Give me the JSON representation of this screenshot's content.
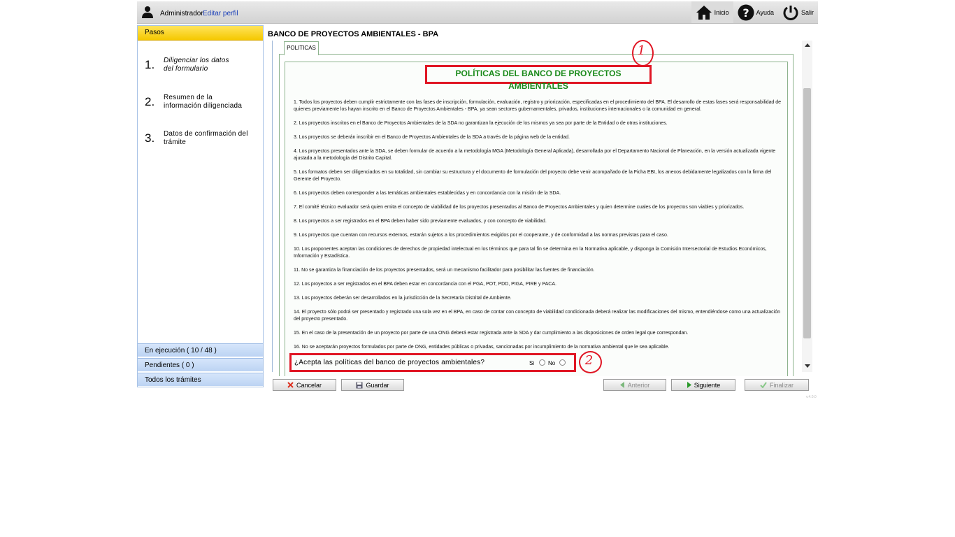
{
  "header": {
    "user_name": "Administrador",
    "edit_profile": "Editar perfil",
    "actions": [
      {
        "label": "Inicio",
        "icon": "home-icon"
      },
      {
        "label": "Ayuda",
        "icon": "help-icon"
      },
      {
        "label": "Salir",
        "icon": "power-icon"
      }
    ]
  },
  "sidebar": {
    "header": "Pasos",
    "steps": [
      {
        "num": "1.",
        "label_line1": "Diligenciar los datos",
        "label_line2": "del formulario"
      },
      {
        "num": "2.",
        "label_line1": "Resumen de la",
        "label_line2": "información diligenciada"
      },
      {
        "num": "3.",
        "label_line1": "Datos de confirmación del",
        "label_line2": "trámite"
      }
    ],
    "footer": [
      {
        "label": "En ejecución ( 10 / 48 )"
      },
      {
        "label": "Pendientes ( 0 )"
      },
      {
        "label": "Todos los trámites"
      }
    ]
  },
  "main": {
    "title": "BANCO DE PROYECTOS AMBIENTALES - BPA",
    "tab_label": "POLITICAS",
    "policy_title": "POLÍTICAS DEL BANCO DE PROYECTOS AMBIENTALES",
    "policies": [
      "1. Todos los proyectos deben cumplir estrictamente con las fases de inscripción, formulación, evaluación, registro y priorización, especificadas en el procedimiento del BPA. El desarrollo de estas fases será responsabilidad de quienes previamente los hayan inscrito en el Banco de Proyectos Ambientales - BPA, ya sean sectores gubernamentales, privados, instituciones internacionales o la comunidad en general.",
      "2. Los proyectos inscritos en el Banco de Proyectos Ambientales de la SDA no garantizan la ejecución de los mismos ya sea por parte de la Entidad o de otras instituciones.",
      "3. Los proyectos se deberán inscribir en el Banco de Proyectos Ambientales de la SDA a través de la página web de la entidad.",
      "4. Los proyectos presentados ante la SDA, se deben formular de acuerdo a la metodología MGA (Metodología General Aplicada), desarrollada por el Departamento Nacional de Planeación, en la versión actualizada vigente ajustada a la metodología del Distrito Capital.",
      "5. Los formatos deben ser diligenciados en su totalidad, sin cambiar su estructura y el documento de formulación del proyecto debe venir acompañado de la Ficha EBI, los anexos debidamente legalizados con la firma del Gerente del Proyecto.",
      "6. Los proyectos deben corresponder a las temáticas ambientales establecidas y en concordancia con la misión de la SDA.",
      "7. El comité técnico evaluador será quien emita el concepto de viabilidad de los proyectos presentados al Banco de Proyectos Ambientales y quien determine cuales de los proyectos son viables y priorizados.",
      "8. Los proyectos a ser registrados en el BPA deben haber sido previamente evaluados, y con concepto de viabilidad.",
      "9. Los proyectos que cuentan con recursos externos, estarán sujetos a los procedimientos exigidos por el cooperante, y de conformidad a las normas previstas para el caso.",
      "10. Los proponentes aceptan las condiciones de derechos de propiedad intelectual en los términos que para tal fin se determina en la Normativa aplicable, y disponga la Comisión Intersectorial de Estudios Económicos, Información y Estadística.",
      "11. No se garantiza la financiación de los proyectos presentados, será un mecanismo facilitador para posibilitar las fuentes de financiación.",
      "12. Los proyectos a ser registrados en el BPA deben estar en concordancia con el PGA, POT, PDD, PIGA, PIRE y PACA.",
      "13. Los proyectos deberán ser desarrollados en la jurisdicción de la Secretaría Distrital de Ambiente.",
      "14. El proyecto sólo podrá ser presentado y registrado una sola vez en el BPA, en caso de contar con concepto de viabilidad condicionada deberá realizar las modificaciones del mismo, entendiéndose como una actualización del proyecto presentado.",
      "15. En el caso de la presentación de un proyecto por parte de una ONG deberá estar registrada ante la SDA y dar cumplimiento a las disposiciones de orden legal que correspondan.",
      "16. No se aceptarán proyectos formulados por parte de ONG, entidades públicas o privadas, sancionadas por incumplimiento de la normativa ambiental que le sea aplicable."
    ],
    "question": "¿Acepta las políticas del banco de proyectos ambientales?",
    "option_yes": "Si",
    "option_no": "No",
    "annotation_1": "1",
    "annotation_2": "2"
  },
  "buttons": {
    "cancel": "Cancelar",
    "save": "Guardar",
    "previous": "Anterior",
    "next": "Siguiente",
    "finish": "Finalizar"
  },
  "footer": {
    "version": "v.4.0.0"
  },
  "colors": {
    "accent_red": "#e01624",
    "title_green": "#1a8a1a",
    "step_header": "#f5c800"
  }
}
